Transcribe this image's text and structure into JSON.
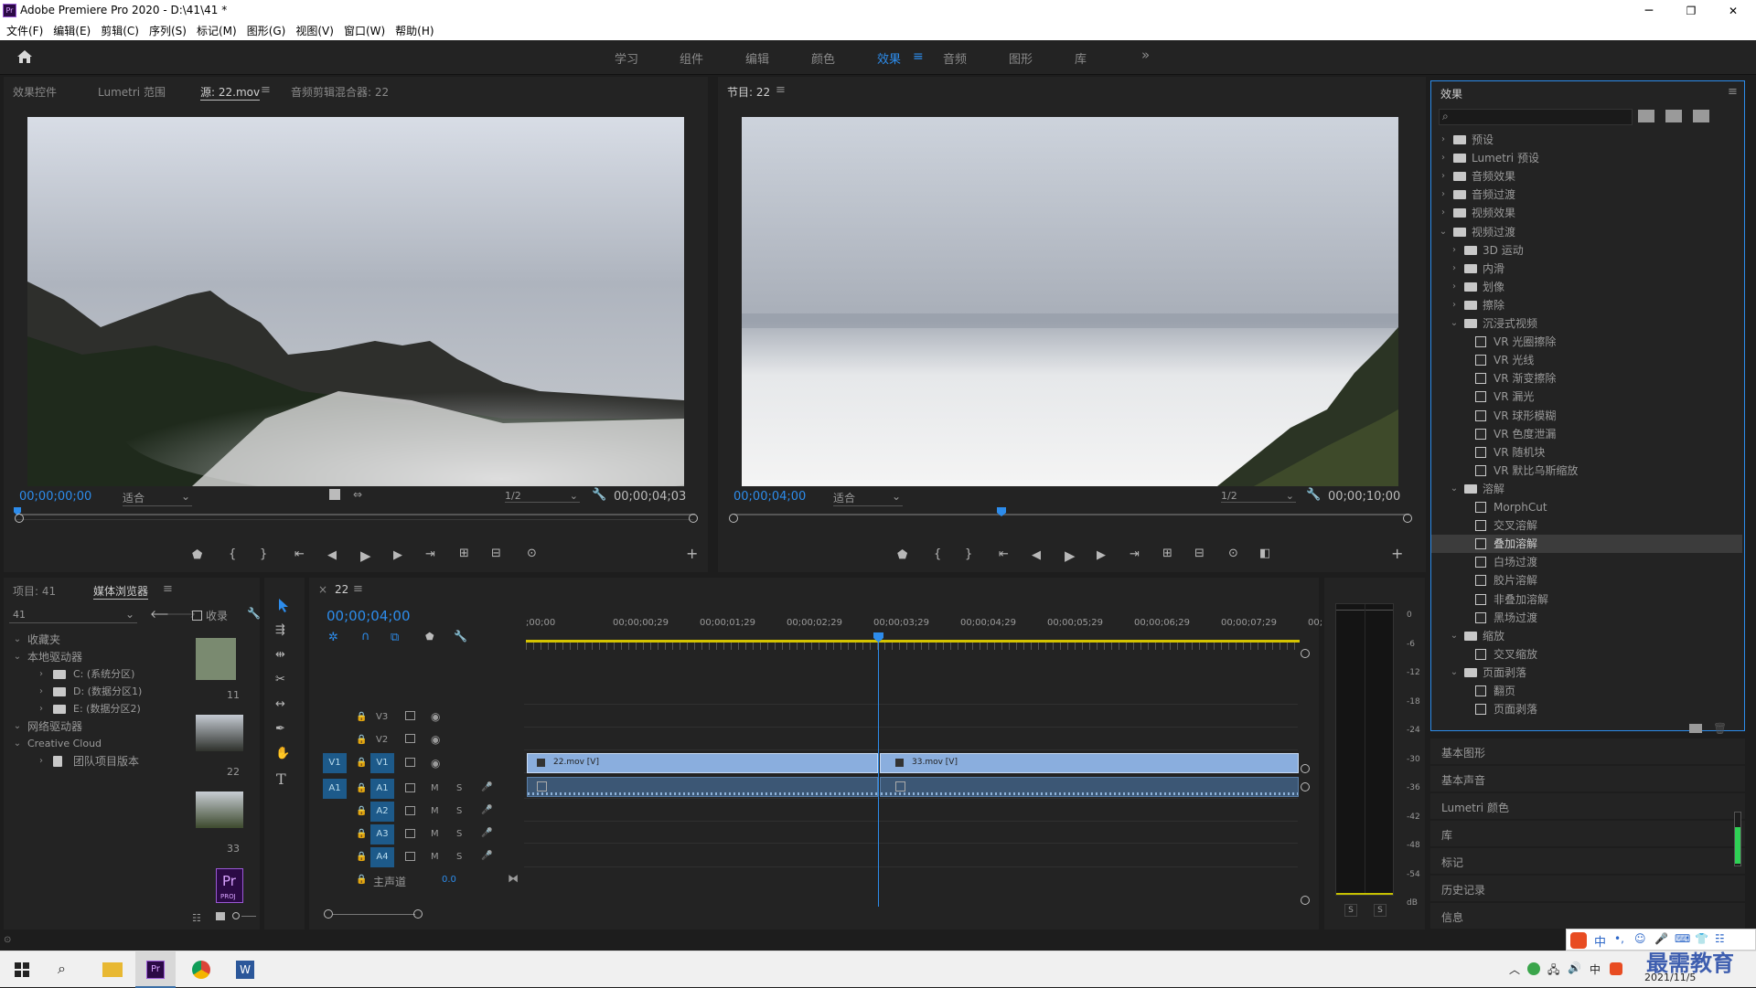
{
  "window": {
    "title": "Adobe Premiere Pro 2020 - D:\\41\\41 *",
    "min": "─",
    "max": "❐",
    "close": "✕"
  },
  "menu": [
    "文件(F)",
    "编辑(E)",
    "剪辑(C)",
    "序列(S)",
    "标记(M)",
    "图形(G)",
    "视图(V)",
    "窗口(W)",
    "帮助(H)"
  ],
  "workspaces": [
    "学习",
    "组件",
    "编辑",
    "颜色",
    "效果",
    "音频",
    "图形",
    "库"
  ],
  "workspace_active": "效果",
  "source_tabs": [
    "效果控件",
    "Lumetri 范围",
    "源: 22.mov",
    "音频剪辑混合器: 22"
  ],
  "source": {
    "timecode": "00;00;00;00",
    "fit": "适合",
    "res": "1/2",
    "duration": "00;00;04;03"
  },
  "program": {
    "tab": "节目: 22",
    "timecode": "00;00;04;00",
    "fit": "适合",
    "res": "1/2",
    "duration": "00;00;10;00"
  },
  "project": {
    "tabs": [
      "项目: 41",
      "媒体浏览器"
    ],
    "path": "41",
    "favorites_label": "收录",
    "tree": [
      "收藏夹",
      "本地驱动器",
      "C: (系统分区)",
      "D: (数据分区1)",
      "E: (数据分区2)",
      "网络驱动器",
      "Creative Cloud",
      "团队项目版本"
    ],
    "thumbs": [
      "11",
      "22",
      "33"
    ],
    "proj_icon": "Pr",
    "proj_sub": "PROJ"
  },
  "timeline": {
    "tab": "22",
    "timecode": "00;00;04;00",
    "ruler": [
      ";00;00",
      "00;00;00;29",
      "00;00;01;29",
      "00;00;02;29",
      "00;00;03;29",
      "00;00;04;29",
      "00;00;05;29",
      "00;00;06;29",
      "00;00;07;29",
      "00;"
    ],
    "video_tracks": [
      "V3",
      "V2",
      "V1"
    ],
    "audio_tracks": [
      "A1",
      "A2",
      "A3",
      "A4"
    ],
    "src_v": "V1",
    "src_a": "A1",
    "m": "M",
    "s": "S",
    "master": "主声道",
    "master_val": "0.0",
    "clip1": "22.mov [V]",
    "clip2": "33.mov [V]"
  },
  "meter": {
    "scale": [
      "0",
      "-6",
      "-12",
      "-18",
      "-24",
      "-30",
      "-36",
      "-42",
      "-48",
      "-54",
      "dB"
    ],
    "solo": [
      "S",
      "S"
    ]
  },
  "effects": {
    "title": "效果",
    "tree": [
      {
        "label": "预设",
        "lvl": 0,
        "t": "folder",
        "open": false
      },
      {
        "label": "Lumetri 预设",
        "lvl": 0,
        "t": "folder",
        "open": false
      },
      {
        "label": "音频效果",
        "lvl": 0,
        "t": "folder",
        "open": false
      },
      {
        "label": "音频过渡",
        "lvl": 0,
        "t": "folder",
        "open": false
      },
      {
        "label": "视频效果",
        "lvl": 0,
        "t": "folder",
        "open": false
      },
      {
        "label": "视频过渡",
        "lvl": 0,
        "t": "folder",
        "open": true
      },
      {
        "label": "3D 运动",
        "lvl": 1,
        "t": "folder",
        "open": false
      },
      {
        "label": "内滑",
        "lvl": 1,
        "t": "folder",
        "open": false
      },
      {
        "label": "划像",
        "lvl": 1,
        "t": "folder",
        "open": false
      },
      {
        "label": "擦除",
        "lvl": 1,
        "t": "folder",
        "open": false
      },
      {
        "label": "沉浸式视频",
        "lvl": 1,
        "t": "folder",
        "open": true
      },
      {
        "label": "VR 光圈擦除",
        "lvl": 2,
        "t": "fx"
      },
      {
        "label": "VR 光线",
        "lvl": 2,
        "t": "fx"
      },
      {
        "label": "VR 渐变擦除",
        "lvl": 2,
        "t": "fx"
      },
      {
        "label": "VR 漏光",
        "lvl": 2,
        "t": "fx"
      },
      {
        "label": "VR 球形模糊",
        "lvl": 2,
        "t": "fx"
      },
      {
        "label": "VR 色度泄漏",
        "lvl": 2,
        "t": "fx"
      },
      {
        "label": "VR 随机块",
        "lvl": 2,
        "t": "fx"
      },
      {
        "label": "VR 默比乌斯缩放",
        "lvl": 2,
        "t": "fx"
      },
      {
        "label": "溶解",
        "lvl": 1,
        "t": "folder",
        "open": true
      },
      {
        "label": "MorphCut",
        "lvl": 2,
        "t": "fx"
      },
      {
        "label": "交叉溶解",
        "lvl": 2,
        "t": "fx"
      },
      {
        "label": "叠加溶解",
        "lvl": 2,
        "t": "fx",
        "selected": true
      },
      {
        "label": "白场过渡",
        "lvl": 2,
        "t": "fx"
      },
      {
        "label": "胶片溶解",
        "lvl": 2,
        "t": "fx"
      },
      {
        "label": "非叠加溶解",
        "lvl": 2,
        "t": "fx"
      },
      {
        "label": "黑场过渡",
        "lvl": 2,
        "t": "fx"
      },
      {
        "label": "缩放",
        "lvl": 1,
        "t": "folder",
        "open": true
      },
      {
        "label": "交叉缩放",
        "lvl": 2,
        "t": "fx"
      },
      {
        "label": "页面剥落",
        "lvl": 1,
        "t": "folder",
        "open": true
      },
      {
        "label": "翻页",
        "lvl": 2,
        "t": "fx"
      },
      {
        "label": "页面剥落",
        "lvl": 2,
        "t": "fx"
      }
    ]
  },
  "side_panels": [
    "基本图形",
    "基本声音",
    "Lumetri 颜色",
    "库",
    "标记",
    "历史记录",
    "信息"
  ],
  "taskbar": {
    "date": "2021/11/5",
    "ime": "中",
    "watermark": "最需教育"
  }
}
